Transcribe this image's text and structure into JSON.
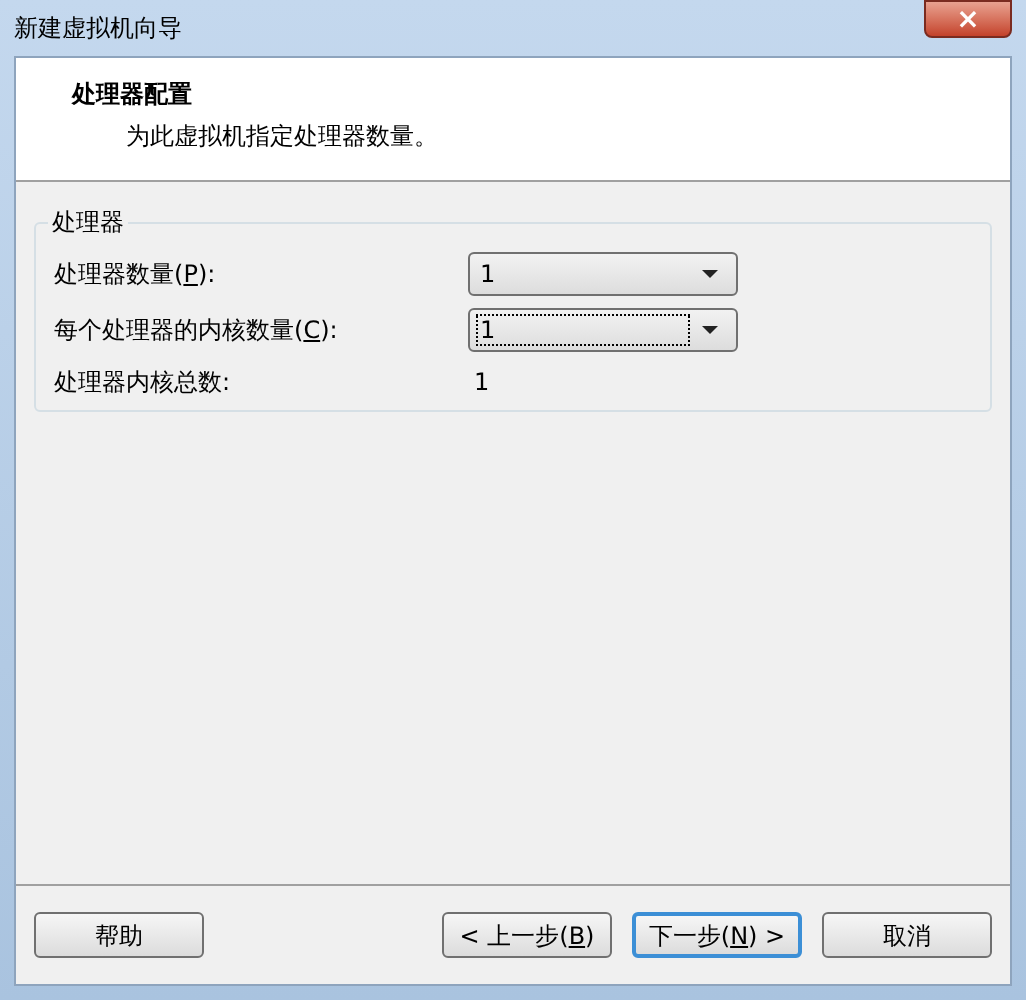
{
  "window": {
    "title": "新建虚拟机向导",
    "close_glyph": "×"
  },
  "header": {
    "title": "处理器配置",
    "subtitle": "为此虚拟机指定处理器数量。"
  },
  "group": {
    "title": "处理器",
    "rows": [
      {
        "kind": "combo",
        "label_before": "处理器数量(",
        "mnemonic": "P",
        "label_after": "):",
        "value": "1",
        "focused": false
      },
      {
        "kind": "combo",
        "label_before": "每个处理器的内核数量(",
        "mnemonic": "C",
        "label_after": "):",
        "value": "1",
        "focused": true
      },
      {
        "kind": "readout",
        "label_before": "处理器内核总数:",
        "value": "1"
      }
    ]
  },
  "buttons": [
    {
      "before": "帮助",
      "default": false
    },
    {
      "before": "< 上一步(",
      "mnemonic": "B",
      "after": ")",
      "default": false
    },
    {
      "before": "下一步(",
      "mnemonic": "N",
      "after": ") >",
      "default": true
    },
    {
      "before": "取消",
      "default": false
    }
  ]
}
